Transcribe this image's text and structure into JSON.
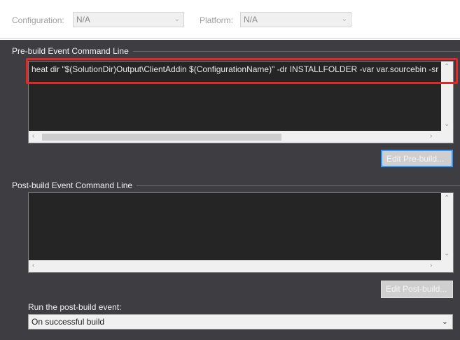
{
  "config_bar": {
    "configuration_label": "Configuration:",
    "configuration_value": "N/A",
    "platform_label": "Platform:",
    "platform_value": "N/A"
  },
  "pre_build": {
    "section_title": "Pre-build Event Command Line",
    "command": "heat dir \"$(SolutionDir)Output\\ClientAddin $(ConfigurationName)\" -dr INSTALLFOLDER -var var.sourcebin -sr",
    "edit_button": "Edit Pre-build..."
  },
  "post_build": {
    "section_title": "Post-build Event Command Line",
    "command": "",
    "edit_button": "Edit Post-build..."
  },
  "run_event": {
    "label": "Run the post-build event:",
    "selected": "On successful build"
  },
  "icons": {
    "dropdown": "chevron-down-icon",
    "scroll_up": "scroll-up-arrow-icon",
    "scroll_down": "scroll-down-arrow-icon",
    "scroll_left": "scroll-left-arrow-icon",
    "scroll_right": "scroll-right-arrow-icon"
  },
  "colors": {
    "panel_background": "#3e3e42",
    "editor_background": "#252526",
    "highlight": "#e02828",
    "focus": "#3399ff"
  }
}
